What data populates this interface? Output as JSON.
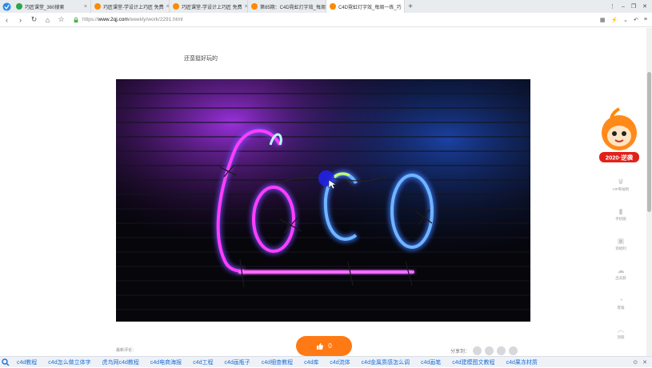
{
  "tabs": [
    {
      "label": "巧匠课堂_360搜索",
      "icon_color": "#2aa84a"
    },
    {
      "label": "巧匠课堂-学设计上巧匠 免费",
      "icon_color": "#ff8a00"
    },
    {
      "label": "巧匠课堂-学设计上巧匠 免费",
      "icon_color": "#ff8a00"
    },
    {
      "label": "第85期：C4D霓虹灯字效_每周",
      "icon_color": "#ff8a00"
    },
    {
      "label": "C4D霓虹灯字效_每周一练_巧",
      "icon_color": "#ff8a00"
    }
  ],
  "tab_close": "×",
  "new_tab": "+",
  "window_controls": {
    "pin": "⋮",
    "min": "–",
    "max": "❐",
    "close": "✕"
  },
  "nav": {
    "back": "‹",
    "forward": "›",
    "reload": "↻",
    "home": "⌂",
    "star": "☆"
  },
  "address": {
    "scheme": "https://",
    "host": "www.2qj.com",
    "path": "/weekly/work/2291.html"
  },
  "nav_right": {
    "grid": "▦",
    "lightning": "⚡",
    "chevron": "⌄",
    "undo": "↶",
    "menu": "≡"
  },
  "page": {
    "caption": "还蛮挺好玩的",
    "comment_label": "最新评论：",
    "like_icon": "like-icon",
    "like_count": "0",
    "share_label": "分享到："
  },
  "neon_text": "CoCo",
  "mascot": {
    "badge": "2020·逆袭"
  },
  "sidebar": [
    {
      "icon": "crown-icon",
      "glyph": "♛",
      "label": "VIP和福利"
    },
    {
      "icon": "phone-icon",
      "glyph": "▮",
      "label": "手机版"
    },
    {
      "icon": "gift-icon",
      "glyph": "▣",
      "label": "领福利"
    },
    {
      "icon": "cloud-icon",
      "glyph": "☁",
      "label": "出去醉"
    },
    {
      "icon": "feedback-icon",
      "glyph": "◔",
      "label": "客服"
    },
    {
      "icon": "top-icon",
      "glyph": "︿",
      "label": "顶部"
    }
  ],
  "keywords": [
    "c4d教程",
    "c4d怎么做立体字",
    "虎鸟网c4d教程",
    "c4d电商海报",
    "c4d工程",
    "c4d画瓶子",
    "c4d细查教程",
    "c4d库",
    "c4d流体",
    "c4d金属质感怎么调",
    "c4d画笔",
    "c4d建模图文教程",
    "c4d果冻材质"
  ],
  "colors": {
    "accent": "#ff7a15",
    "link": "#1e6fd9",
    "neon_pink": "#ff3dff",
    "neon_blue": "#4da6ff"
  }
}
